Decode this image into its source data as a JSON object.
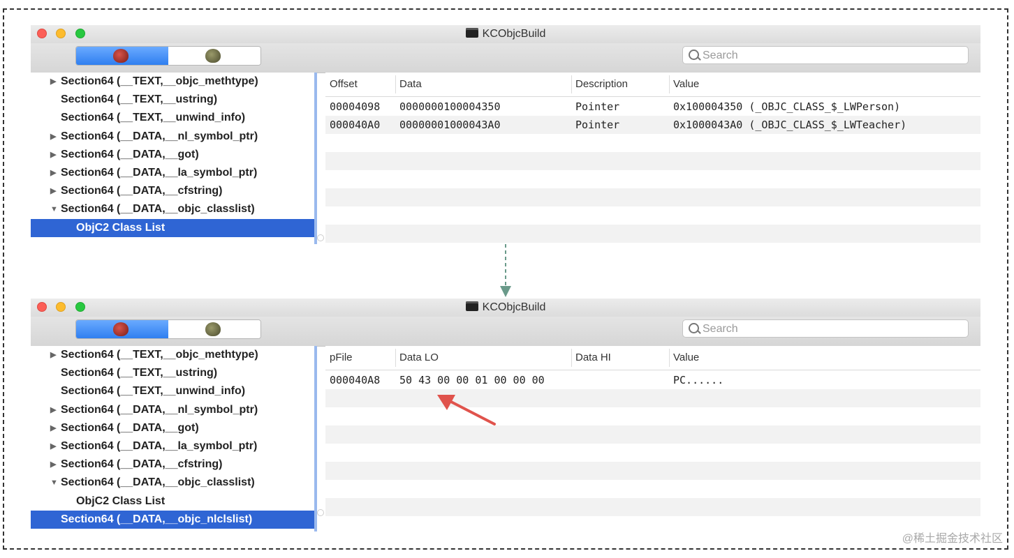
{
  "windows": [
    {
      "title": "KCObjcBuild",
      "search_placeholder": "Search",
      "sidebar": [
        {
          "label": "Section64 (__TEXT,__objc_methtype)",
          "arrow": "▶",
          "child": false,
          "selected": false
        },
        {
          "label": "Section64 (__TEXT,__ustring)",
          "arrow": "",
          "child": false,
          "selected": false
        },
        {
          "label": "Section64 (__TEXT,__unwind_info)",
          "arrow": "",
          "child": false,
          "selected": false
        },
        {
          "label": "Section64 (__DATA,__nl_symbol_ptr)",
          "arrow": "▶",
          "child": false,
          "selected": false
        },
        {
          "label": "Section64 (__DATA,__got)",
          "arrow": "▶",
          "child": false,
          "selected": false
        },
        {
          "label": "Section64 (__DATA,__la_symbol_ptr)",
          "arrow": "▶",
          "child": false,
          "selected": false
        },
        {
          "label": "Section64 (__DATA,__cfstring)",
          "arrow": "▶",
          "child": false,
          "selected": false
        },
        {
          "label": "Section64 (__DATA,__objc_classlist)",
          "arrow": "▼",
          "child": false,
          "selected": false
        },
        {
          "label": "ObjC2 Class List",
          "arrow": "",
          "child": true,
          "selected": true
        }
      ],
      "columns": [
        "Offset",
        "Data",
        "Description",
        "Value"
      ],
      "rows": [
        [
          "00004098",
          "0000000100004350",
          "Pointer",
          "0x100004350 (_OBJC_CLASS_$_LWPerson)"
        ],
        [
          "000040A0",
          "00000001000043A0",
          "Pointer",
          "0x1000043A0 (_OBJC_CLASS_$_LWTeacher)"
        ]
      ]
    },
    {
      "title": "KCObjcBuild",
      "search_placeholder": "Search",
      "sidebar": [
        {
          "label": "Section64 (__TEXT,__objc_methtype)",
          "arrow": "▶",
          "child": false,
          "selected": false
        },
        {
          "label": "Section64 (__TEXT,__ustring)",
          "arrow": "",
          "child": false,
          "selected": false
        },
        {
          "label": "Section64 (__TEXT,__unwind_info)",
          "arrow": "",
          "child": false,
          "selected": false
        },
        {
          "label": "Section64 (__DATA,__nl_symbol_ptr)",
          "arrow": "▶",
          "child": false,
          "selected": false
        },
        {
          "label": "Section64 (__DATA,__got)",
          "arrow": "▶",
          "child": false,
          "selected": false
        },
        {
          "label": "Section64 (__DATA,__la_symbol_ptr)",
          "arrow": "▶",
          "child": false,
          "selected": false
        },
        {
          "label": "Section64 (__DATA,__cfstring)",
          "arrow": "▶",
          "child": false,
          "selected": false
        },
        {
          "label": "Section64 (__DATA,__objc_classlist)",
          "arrow": "▼",
          "child": false,
          "selected": false
        },
        {
          "label": "ObjC2 Class List",
          "arrow": "",
          "child": true,
          "selected": false
        },
        {
          "label": "Section64 (__DATA,__objc_nlclslist)",
          "arrow": "",
          "child": false,
          "selected": true
        }
      ],
      "columns": [
        "pFile",
        "Data LO",
        "Data HI",
        "Value"
      ],
      "rows": [
        [
          "000040A8",
          "50 43 00 00 01 00 00 00",
          "",
          "PC......"
        ]
      ]
    }
  ],
  "watermark": "@稀土掘金技术社区",
  "colors": {
    "selection": "#2f65d4",
    "arrow_red": "#e0534c",
    "arrow_green": "#6a9a8a"
  }
}
